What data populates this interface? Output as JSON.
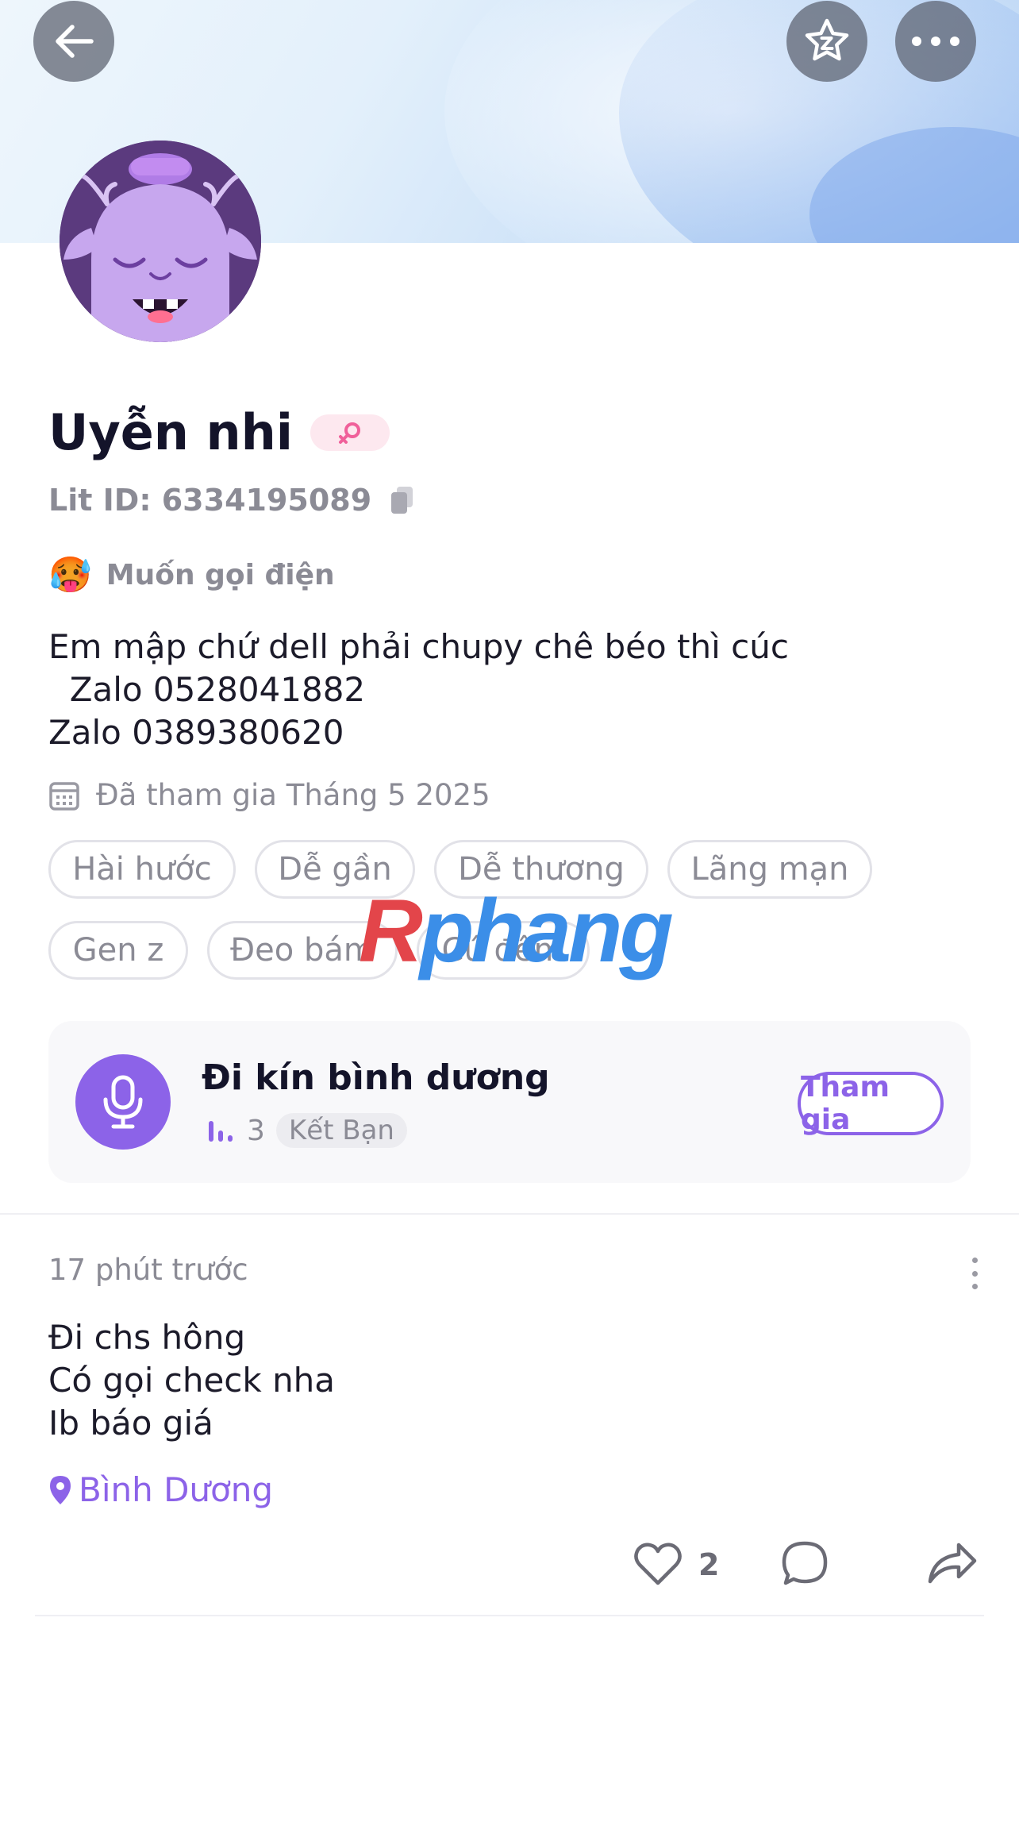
{
  "header": {
    "back_icon": "arrow-left-icon",
    "favorite_icon": "star-icon",
    "more_icon": "more-horizontal-icon"
  },
  "profile": {
    "name": "Uyễn nhi",
    "gender_icon": "female-icon",
    "lit_id": "Lit ID: 6334195089",
    "copy_icon": "copy-icon",
    "status_emoji": "🥵",
    "status_text": "Muốn gọi điện",
    "bio": "Em mập chứ dell phải chupy chê béo thì cúc\n  Zalo 0528041882\nZalo 0389380620",
    "joined": "Đã tham gia Tháng 5 2025",
    "tags": [
      "Hài hước",
      "Dễ gần",
      "Dễ thương",
      "Lãng mạn",
      "Gen z",
      "Đeo bám",
      "Cú đêm"
    ]
  },
  "watermark": {
    "part1": "R",
    "part2": "phang"
  },
  "room": {
    "name": "Đi kín bình dương",
    "listeners": "3",
    "badge": "Kết Bạn",
    "join_label": "Tham gia"
  },
  "post": {
    "time": "17 phút trước",
    "body": "Đi chs hông\nCó gọi check nha\nIb báo giá",
    "location": "Bình Dương",
    "like_count": "2"
  },
  "colors": {
    "accent": "#8c63e8",
    "female": "#f0609a"
  }
}
